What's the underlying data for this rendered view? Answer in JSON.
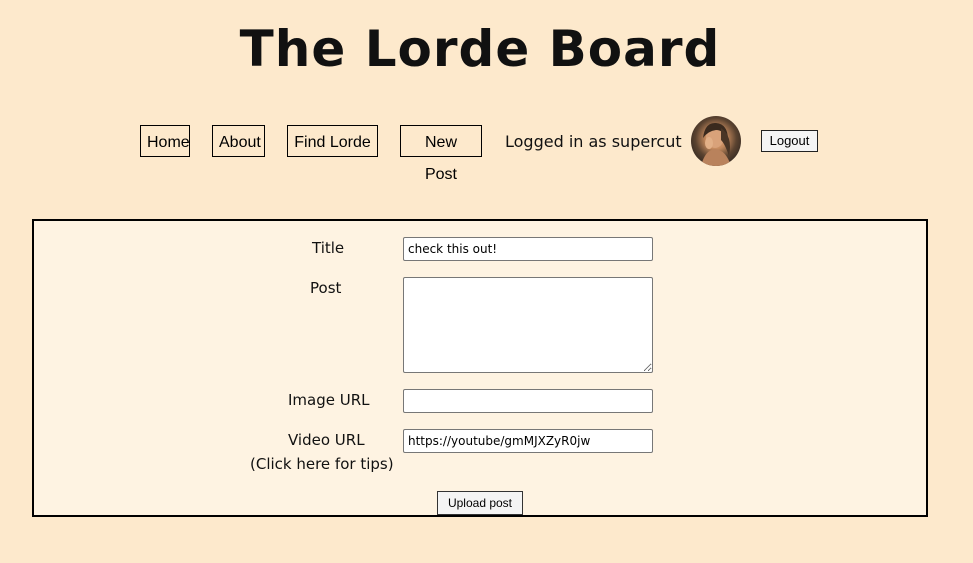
{
  "site": {
    "title": "The Lorde Board"
  },
  "nav": {
    "items": [
      {
        "label": "Home"
      },
      {
        "label": "About"
      },
      {
        "label": "Find Lorde"
      },
      {
        "label": "New Post"
      }
    ],
    "status_text": "Logged in as supercut",
    "logout_label": "Logout"
  },
  "form": {
    "title_label": "Title",
    "title_value": "check this out!",
    "post_label": "Post",
    "post_value": "",
    "image_url_label": "Image URL",
    "image_url_value": "",
    "video_url_label": "Video URL",
    "video_tips_text": "(Click here for tips)",
    "video_url_value": "https://youtube/gmMJXZyR0jw",
    "upload_label": "Upload post"
  },
  "colors": {
    "page_background": "#fde9cc",
    "panel_background": "#fef3e2"
  }
}
